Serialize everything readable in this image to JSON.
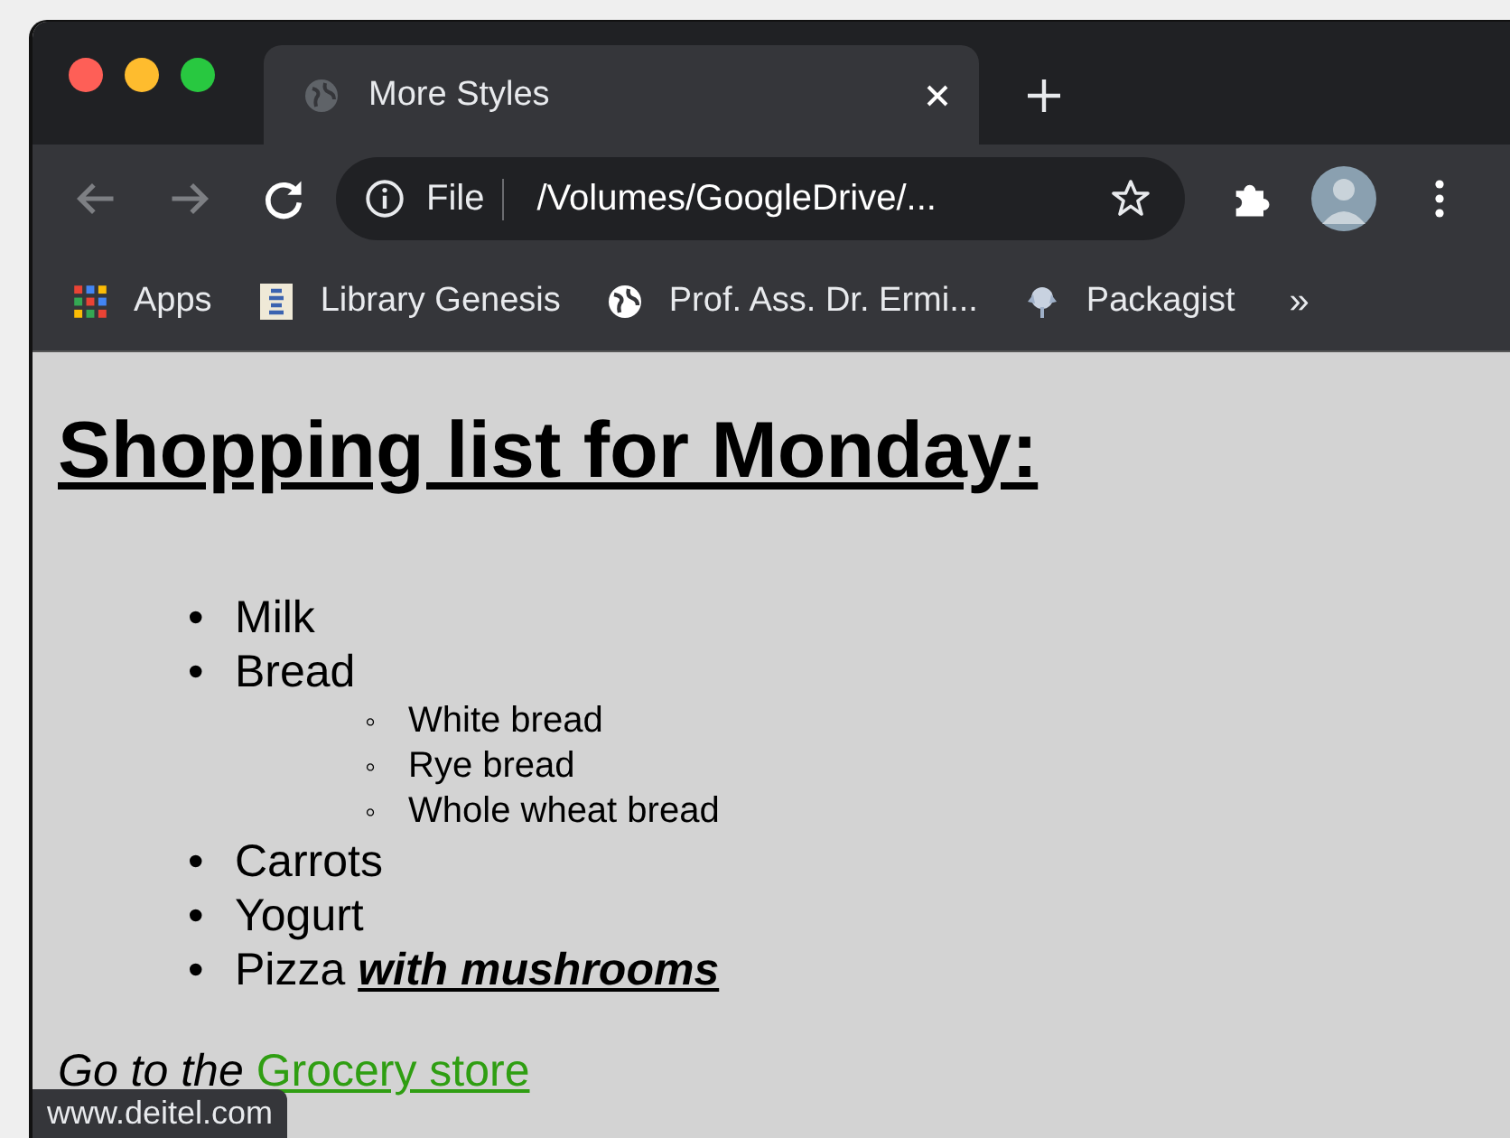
{
  "window": {
    "tab_title": "More Styles",
    "address": {
      "scheme": "File",
      "path": "/Volumes/GoogleDrive/..."
    }
  },
  "bookmarks": [
    {
      "label": "Apps",
      "kind": "apps"
    },
    {
      "label": "Library Genesis",
      "kind": "book"
    },
    {
      "label": "Prof. Ass. Dr. Ermi...",
      "kind": "globe"
    },
    {
      "label": "Packagist",
      "kind": "package"
    }
  ],
  "bookmarks_overflow": "»",
  "page": {
    "heading": "Shopping list for Monday:",
    "items": [
      {
        "marker": "•",
        "text": "Milk"
      },
      {
        "marker": "•",
        "text": "Bread",
        "children": [
          {
            "marker": "◦",
            "text": "White bread"
          },
          {
            "marker": "◦",
            "text": "Rye bread"
          },
          {
            "marker": "◦",
            "text": "Whole wheat bread"
          }
        ]
      },
      {
        "marker": "•",
        "text": "Carrots"
      },
      {
        "marker": "•",
        "text": "Yogurt"
      },
      {
        "marker": "•",
        "text": "Pizza",
        "emphasis": "with mushrooms"
      }
    ],
    "paragraph": {
      "text": "Go to the",
      "link": "Grocery store"
    }
  },
  "status_bar": "www.deitel.com"
}
